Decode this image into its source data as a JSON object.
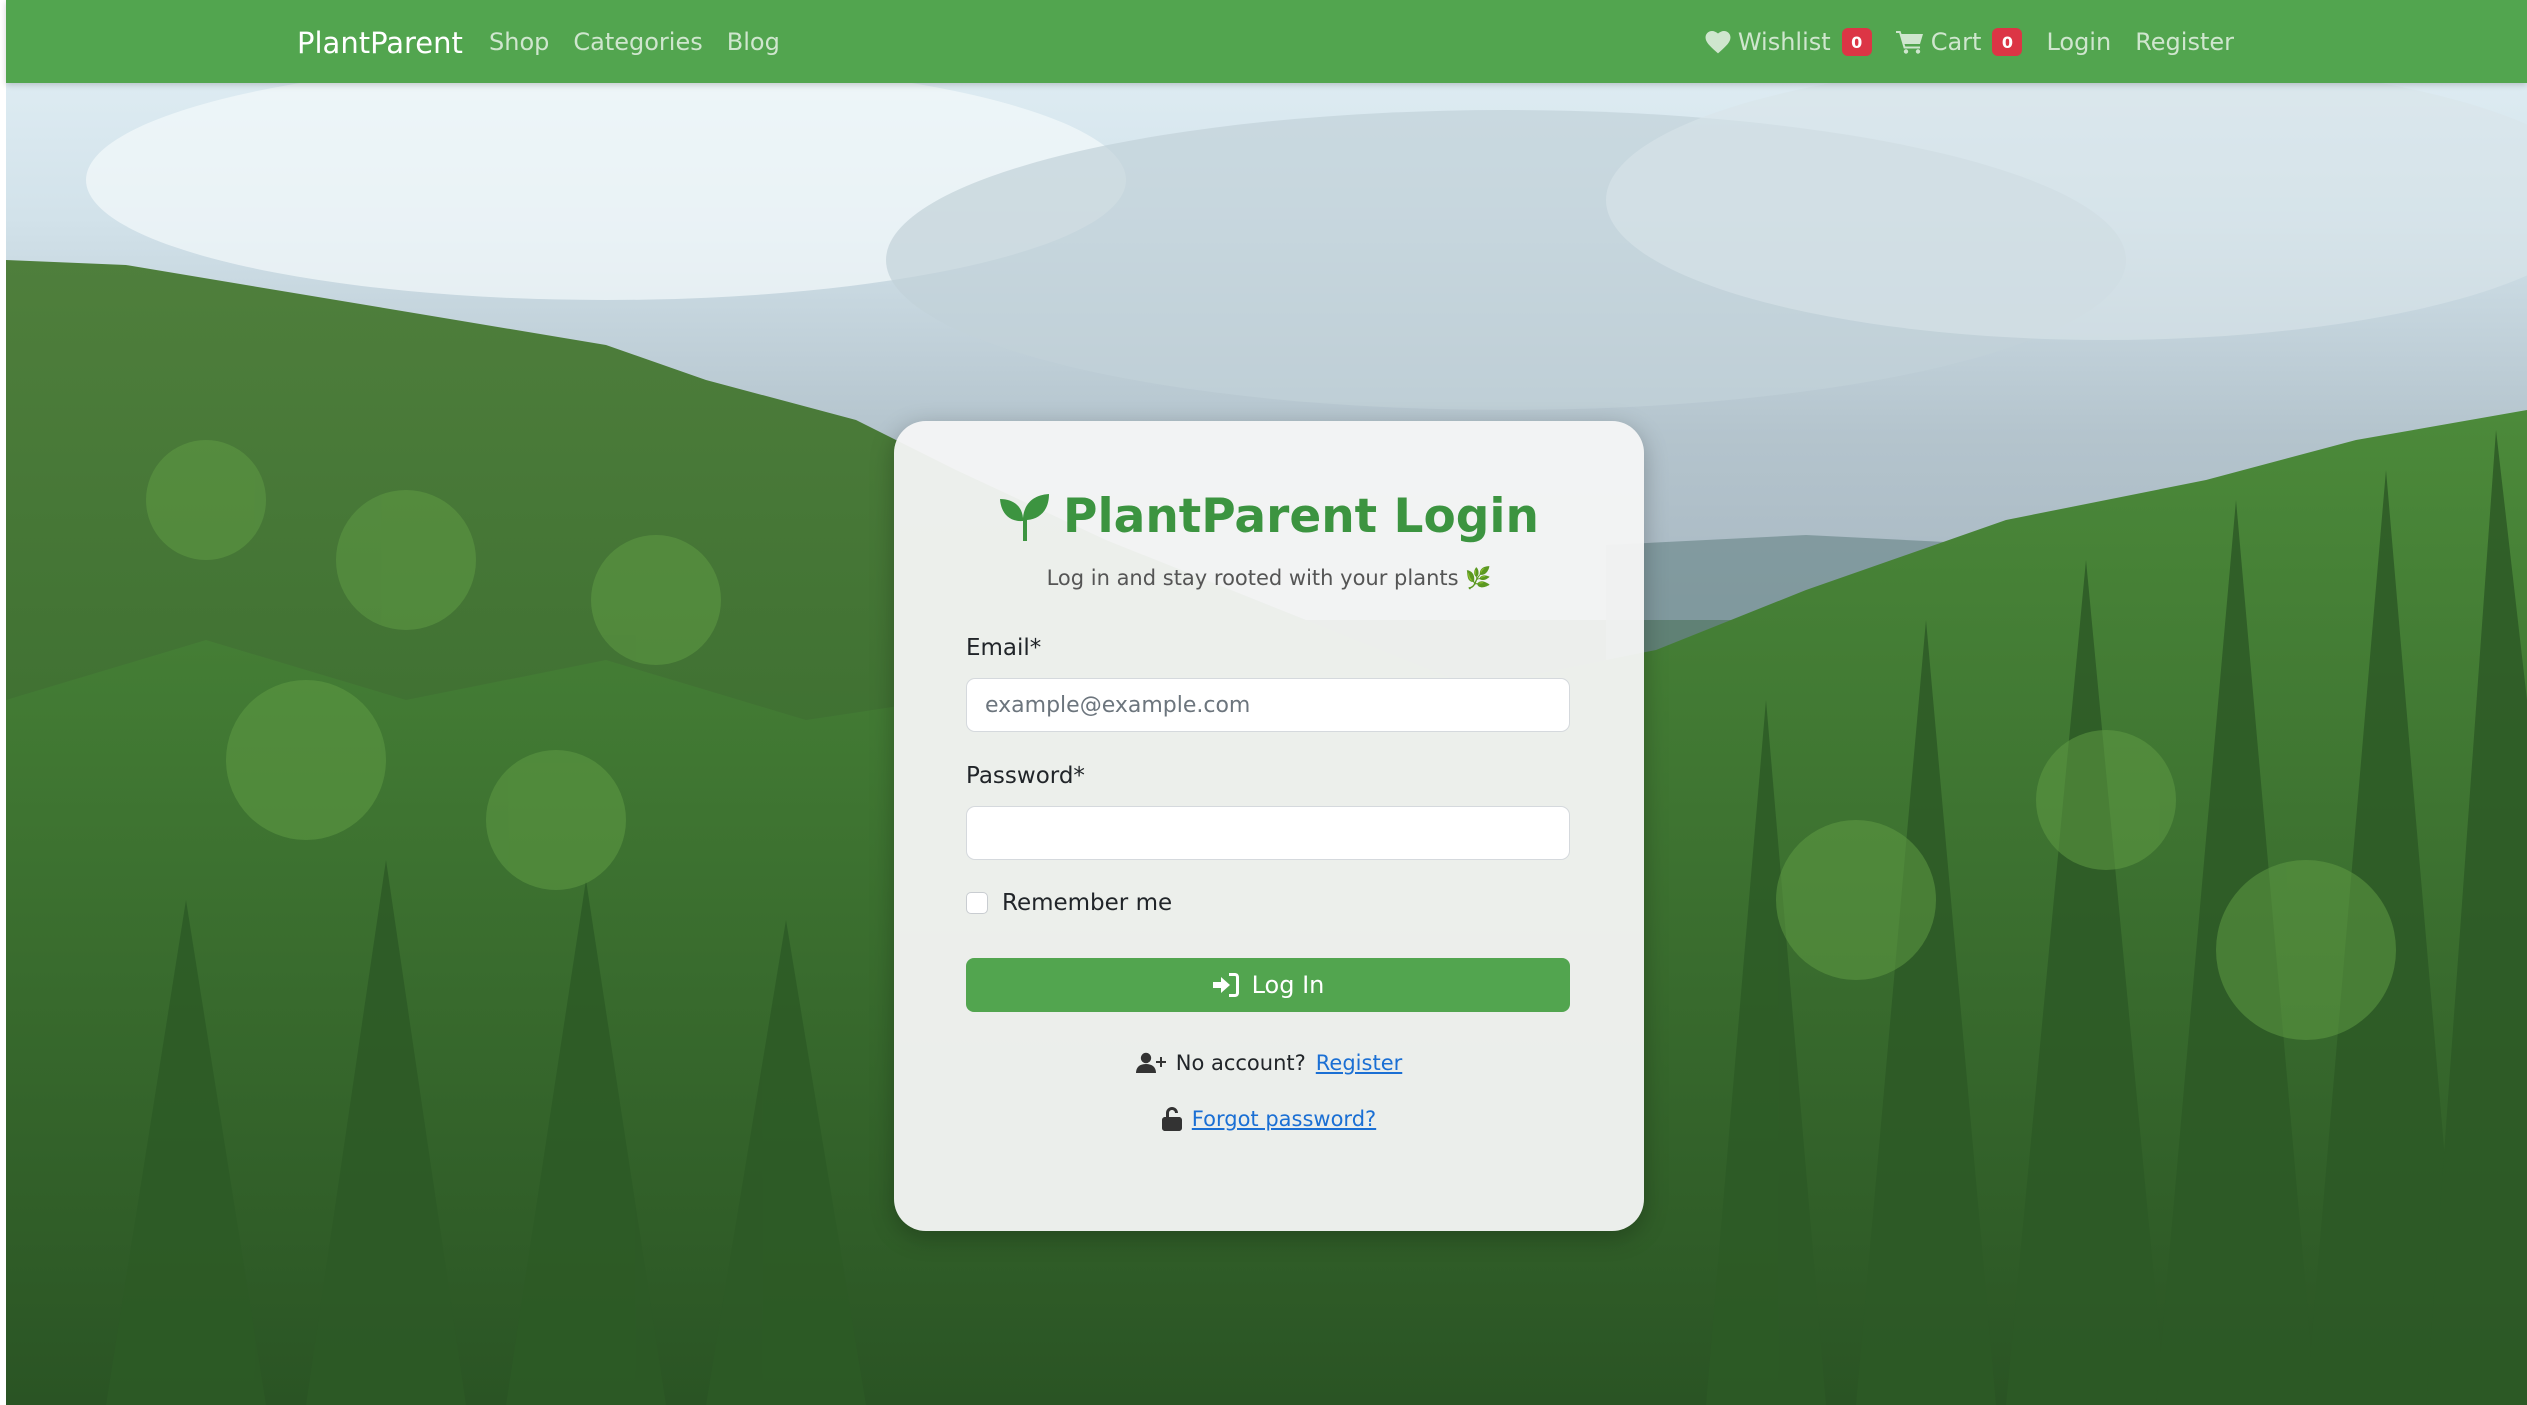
{
  "navbar": {
    "brand": "PlantParent",
    "left_links": [
      "Shop",
      "Categories",
      "Blog"
    ],
    "wishlist": {
      "label": "Wishlist",
      "count": "0",
      "icon": "heart-icon"
    },
    "cart": {
      "label": "Cart",
      "count": "0",
      "icon": "cart-icon"
    },
    "login": "Login",
    "register": "Register"
  },
  "card": {
    "title": "PlantParent Login",
    "title_icon": "seedling-icon",
    "subtitle": "Log in and stay rooted with your plants",
    "subtitle_emoji": "🌿",
    "email": {
      "label": "Email*",
      "placeholder": "example@example.com",
      "value": ""
    },
    "password": {
      "label": "Password*",
      "value": ""
    },
    "remember_label": "Remember me",
    "remember_checked": false,
    "login_button": "Log In",
    "login_icon": "sign-in-icon",
    "no_account_text": "No account?",
    "no_account_link": "Register",
    "no_account_icon": "user-plus-icon",
    "forgot_link": "Forgot password?",
    "forgot_icon": "unlock-icon"
  },
  "colors": {
    "primary": "#52a54f",
    "title_green": "#3c9440",
    "badge": "#dc3545",
    "link": "#1a6fd4"
  }
}
